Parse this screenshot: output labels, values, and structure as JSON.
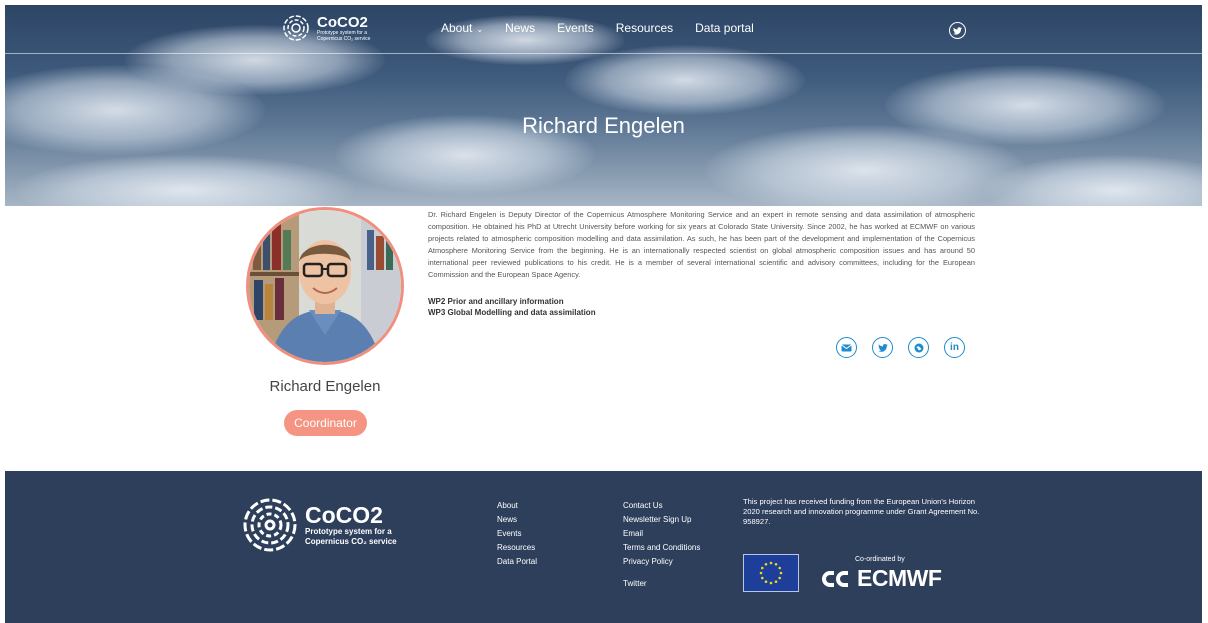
{
  "header": {
    "logo_title": "CoCO2",
    "logo_subtitle": "Prototype system for a Copernicus CO₂ service",
    "nav": [
      {
        "label": "About"
      },
      {
        "label": "News"
      },
      {
        "label": "Events"
      },
      {
        "label": "Resources"
      },
      {
        "label": "Data portal"
      }
    ],
    "twitter_icon": "twitter-icon"
  },
  "hero": {
    "title": "Richard Engelen"
  },
  "profile": {
    "name": "Richard Engelen",
    "role": "Coordinator",
    "bio": "Dr. Richard Engelen is Deputy Director of the Copernicus Atmosphere Monitoring Service and an expert in remote sensing and data assimilation of atmospheric composition. He obtained his PhD at Utrecht University before working for six years at Colorado State University. Since 2002, he has worked at ECMWF on various projects related to atmospheric composition modelling and data assimilation. As such, he has been part of the development and implementation of the Copernicus Atmosphere Monitoring Service from the beginning. He is an internationally respected scientist on global atmospheric composition issues and has around 50 international peer reviewed publications to his credit. He is a member of several international scientific and advisory committees, including for the European Commission and the European Space Agency.",
    "work_packages": [
      "WP2 Prior and ancillary information",
      "WP3 Global Modelling and data assimilation"
    ],
    "social_icons": [
      "email-icon",
      "twitter-icon",
      "website-icon",
      "linkedin-icon"
    ],
    "accent_color": "#1f8dcc",
    "badge_color": "#f59483"
  },
  "footer": {
    "logo_title": "CoCO2",
    "logo_subtitle_line1": "Prototype system for a",
    "logo_subtitle_line2": "Copernicus CO₂ service",
    "col1": [
      "About",
      "News",
      "Events",
      "Resources",
      "Data Portal"
    ],
    "col2": [
      "Contact Us",
      "Newsletter Sign Up",
      "Email",
      "Terms and Conditions",
      "Privacy Policy"
    ],
    "twitter_link": "Twitter",
    "funding_text": "This project has received funding from the European Union's Horizon 2020 research and innovation programme under Grant Agreement No. 958927.",
    "coordinated_by": "Co-ordinated by",
    "ecmwf_label": "ECMWF",
    "background_color": "#2e3f5c"
  }
}
